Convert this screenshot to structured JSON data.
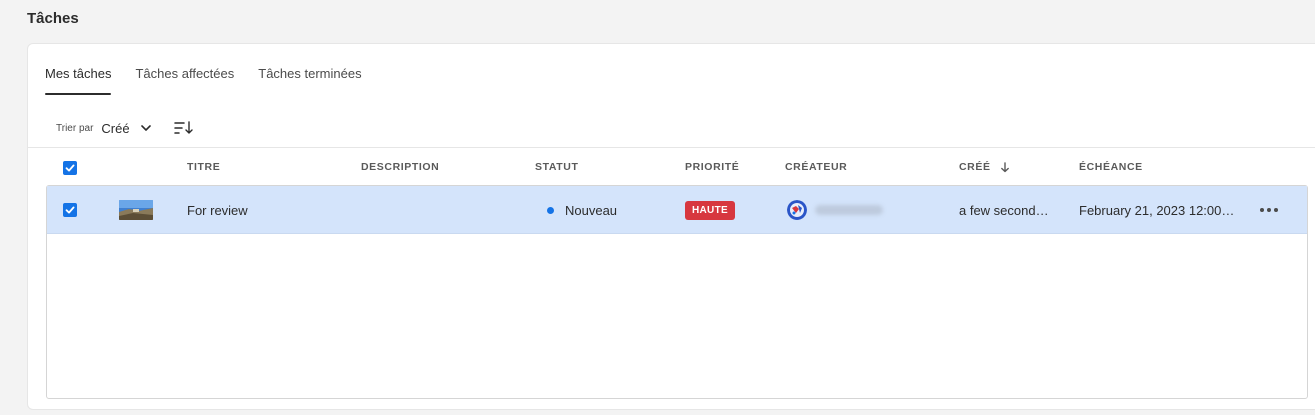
{
  "page": {
    "title": "Tâches"
  },
  "tabs": [
    {
      "label": "Mes tâches",
      "active": true
    },
    {
      "label": "Tâches affectées",
      "active": false
    },
    {
      "label": "Tâches terminées",
      "active": false
    }
  ],
  "sort": {
    "label": "Trier par",
    "value": "Créé"
  },
  "columns": {
    "title": "TITRE",
    "description": "DESCRIPTION",
    "status": "STATUT",
    "priority": "PRIORITÉ",
    "creator": "CRÉATEUR",
    "created": "CRÉÉ",
    "due": "ÉCHÉANCE"
  },
  "rows": [
    {
      "selected": true,
      "title": "For review",
      "description": "",
      "status": "Nouveau",
      "priority": "HAUTE",
      "created": "a few second…",
      "due": "February 21, 2023 12:00…"
    }
  ],
  "colors": {
    "accent": "#1473e6",
    "priority_high": "#d7373f",
    "status_new": "#1473e6",
    "row_selected": "#d4e4fb"
  }
}
